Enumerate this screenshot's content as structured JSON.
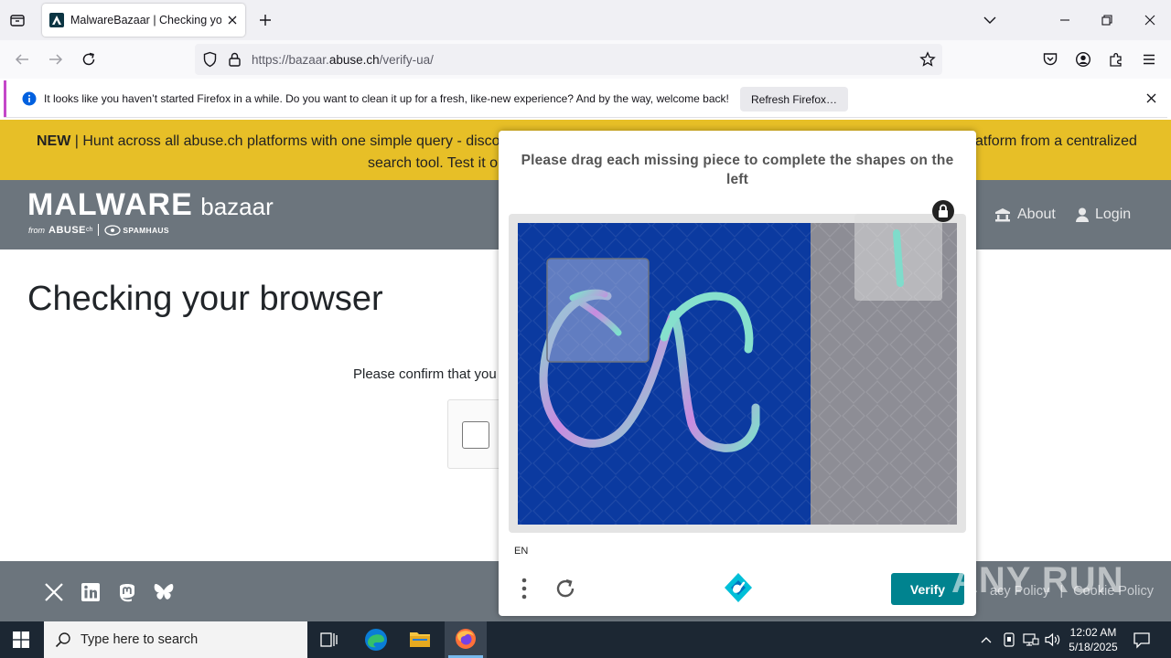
{
  "browser": {
    "tab_title": "MalwareBazaar | Checking your",
    "url_prefix": "https://bazaar.",
    "url_domain": "abuse.ch",
    "url_path": "/verify-ua/",
    "notification_text": "It looks like you haven’t started Firefox in a while. Do you want to clean it up for a fresh, like-new experience? And by the way, welcome back!",
    "refresh_button": "Refresh Firefox…"
  },
  "page": {
    "banner_bold": "NEW",
    "banner_line1_left": " | Hunt across all abuse.ch platforms with one simple query - discov",
    "banner_line1_right": "atform from a centralized",
    "banner_line2": "search tool. Test it ou",
    "logo_main": "MALWARE",
    "logo_sub": "bazaar",
    "logo_from": "from",
    "logo_abuse": "ABUSE",
    "logo_abuse_suffix": "ch",
    "logo_spamhaus": "SPAMHAUS",
    "nav_about": "About",
    "nav_login": "Login",
    "heading": "Checking your browser",
    "confirm_text": "Please confirm that you",
    "footer_privacy": "acy Policy",
    "footer_sep": "|",
    "footer_cookie": "Cookie Policy"
  },
  "captcha": {
    "title": "Please drag each missing piece to complete the shapes on the left",
    "language": "EN",
    "verify_label": "Verify"
  },
  "watermark": "ANY RUN",
  "taskbar": {
    "search_placeholder": "Type here to search",
    "time": "12:02 AM",
    "date": "5/18/2025"
  },
  "colors": {
    "banner": "#e7bf27",
    "header": "#6c757d",
    "verify": "#00838f",
    "puzzle_bg": "#0b3aa0"
  }
}
